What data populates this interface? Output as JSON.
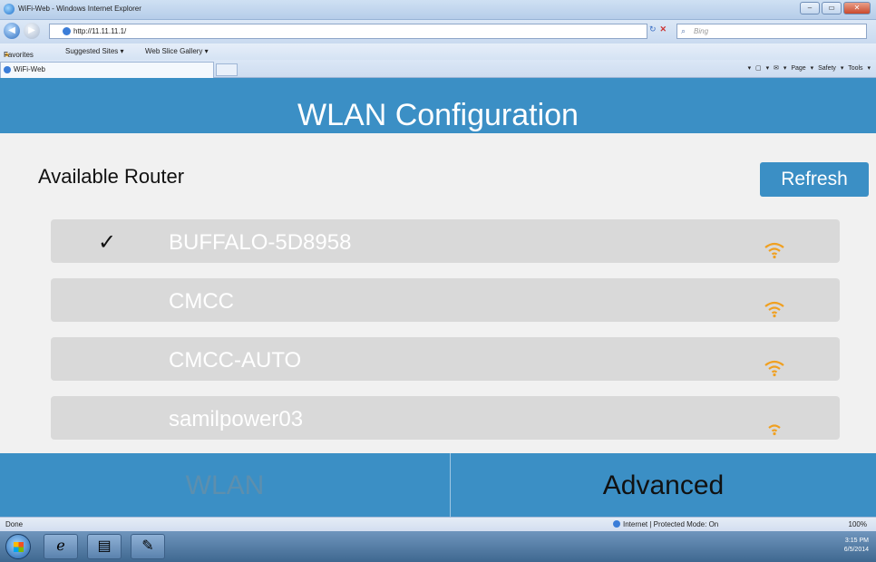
{
  "window": {
    "title": "WiFi-Web - Windows Internet Explorer",
    "url": "http://11.11.11.1/",
    "search_placeholder": "Bing",
    "favorites_label": "Favorites",
    "suggested_sites": "Suggested Sites ▾",
    "web_slice_gallery": "Web Slice Gallery ▾",
    "tab_label": "WiFi-Web",
    "command_bar": "▾ ▢ ▾ ✉ ▾ Page ▾ Safety ▾ Tools ▾"
  },
  "page": {
    "header_title": "WLAN Configuration",
    "section_title": "Available Router",
    "refresh_label": "Refresh",
    "routers": [
      {
        "ssid": "BUFFALO-5D8958",
        "connected": true,
        "check": "✓"
      },
      {
        "ssid": "CMCC",
        "connected": false
      },
      {
        "ssid": "CMCC-AUTO",
        "connected": false
      },
      {
        "ssid": "samilpower03",
        "connected": false
      }
    ],
    "wifi_color": "#f0a020",
    "accent": "#3b8fc5",
    "nav": {
      "wlan": "WLAN",
      "advanced": "Advanced"
    }
  },
  "statusbar": {
    "status": "Done",
    "zone": "Internet | Protected Mode: On",
    "zoom": "100%"
  },
  "taskbar": {
    "time": "3:15 PM",
    "date": "6/5/2014"
  }
}
